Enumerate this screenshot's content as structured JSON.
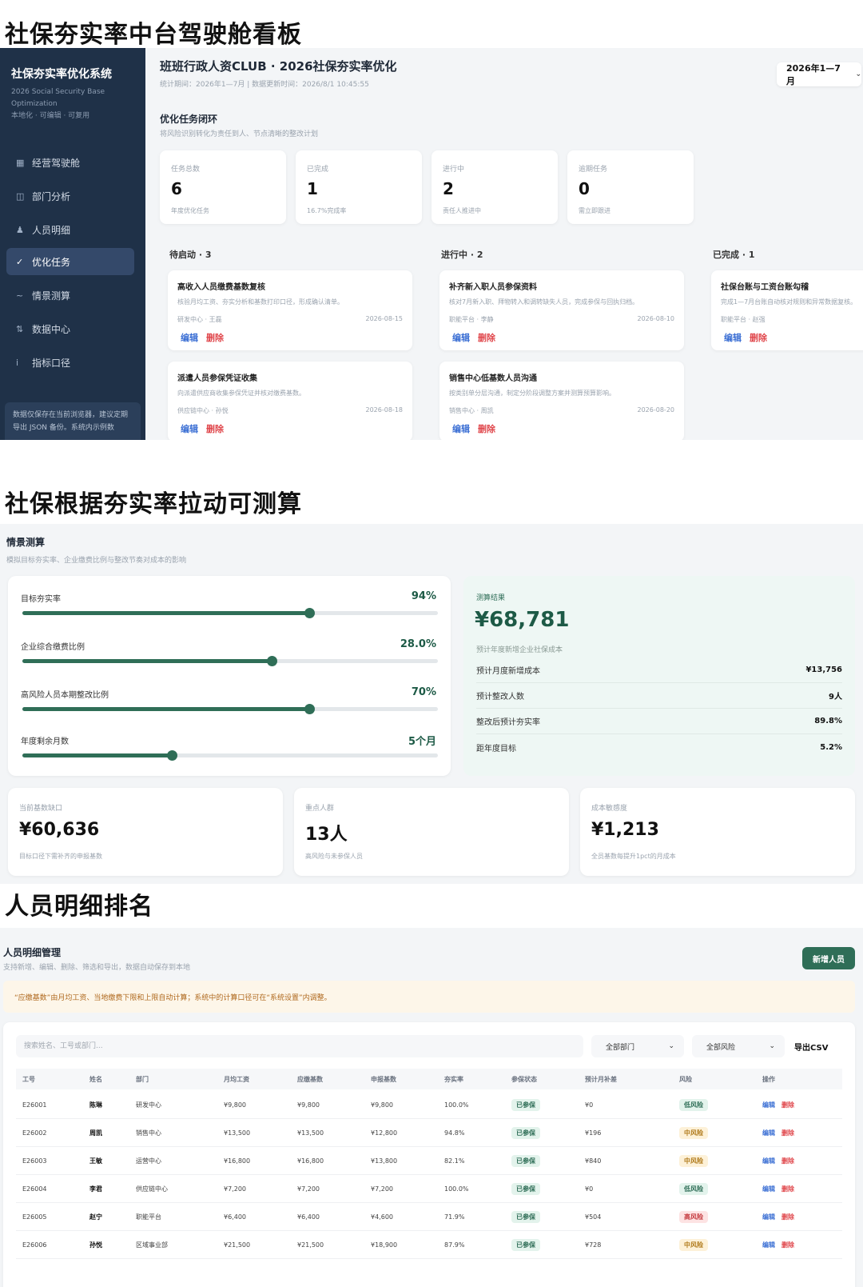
{
  "headings": {
    "h1": "社保夯实率中台驾驶舱看板",
    "h2": "社保根据夯实率拉动可测算",
    "h3": "人员明细排名"
  },
  "sidebar": {
    "title": "社保夯实率优化系统",
    "subtitle_line1": "2026 Social Security Base",
    "subtitle_line2": "Optimization",
    "subtitle_line3": "本地化 · 可编辑 · 可复用",
    "items": [
      {
        "icon": "▦",
        "label": "经营驾驶舱"
      },
      {
        "icon": "◫",
        "label": "部门分析"
      },
      {
        "icon": "♟",
        "label": "人员明细"
      },
      {
        "icon": "✓",
        "label": "优化任务"
      },
      {
        "icon": "~",
        "label": "情景测算"
      },
      {
        "icon": "⇅",
        "label": "数据中心"
      },
      {
        "icon": "i",
        "label": "指标口径"
      }
    ],
    "note": "数据仅保存在当前浏览器，建议定期导出 JSON 备份。系统内示例数"
  },
  "dashboard": {
    "title": "班班行政人资CLUB · 2026社保夯实率优化",
    "meta": "统计期间：2026年1—7月 | 数据更新时间：2026/8/1 10:45:55",
    "period": "2026年1—7月",
    "section_title": "优化任务闭环",
    "section_desc": "将风险识别转化为责任到人、节点清晰的整改计划",
    "stats": [
      {
        "label": "任务总数",
        "value": "6",
        "note": "年度优化任务"
      },
      {
        "label": "已完成",
        "value": "1",
        "note": "16.7%完成率"
      },
      {
        "label": "进行中",
        "value": "2",
        "note": "责任人推进中"
      },
      {
        "label": "逾期任务",
        "value": "0",
        "note": "需立即跟进"
      }
    ],
    "columns": [
      {
        "title": "待启动 · 3"
      },
      {
        "title": "进行中 · 2"
      },
      {
        "title": "已完成 · 1"
      }
    ],
    "tasks": [
      {
        "title": "高收入人员缴费基数复核",
        "desc": "核验月均工资、夯实分析和基数打印口径，形成确认清单。",
        "meta": "研发中心 · 王磊",
        "date": "2026-08-15",
        "edit": "编辑",
        "del": "删除"
      },
      {
        "title": "派遣人员参保凭证收集",
        "desc": "向派遣供应商收集参保凭证并核对缴费基数。",
        "meta": "供应链中心 · 孙悦",
        "date": "2026-08-18",
        "edit": "编辑",
        "del": "删除"
      },
      {
        "title": "补齐新入职人员参保资料",
        "desc": "核对7月新入职、拜物转入和调转缺失人员，完成参保与回执归档。",
        "meta": "职能平台 · 李静",
        "date": "2026-08-10",
        "edit": "编辑",
        "del": "删除"
      },
      {
        "title": "销售中心低基数人员沟通",
        "desc": "按类别单分层沟通，制定分阶段调整方案并测算预算影响。",
        "meta": "销售中心 · 周凯",
        "date": "2026-08-20",
        "edit": "编辑",
        "del": "删除"
      },
      {
        "title": "社保台账与工资台账勾稽",
        "desc": "完成1—7月台账自动核对规则和异常数据复核。",
        "meta": "职能平台 · 赵强",
        "date": "",
        "edit": "编辑",
        "del": "删除"
      }
    ]
  },
  "scenario": {
    "title": "情景测算",
    "desc": "模拟目标夯实率、企业缴费比例与整改节奏对成本的影响",
    "sliders": [
      {
        "label": "目标夯实率",
        "display": "94%",
        "fraction": 0.69
      },
      {
        "label": "企业综合缴费比例",
        "display": "28.0%",
        "fraction": 0.6
      },
      {
        "label": "高风险人员本期整改比例",
        "display": "70%",
        "fraction": 0.69
      },
      {
        "label": "年度剩余月数",
        "display": "5个月",
        "fraction": 0.36
      }
    ],
    "result": {
      "label": "测算结果",
      "value": "¥68,781",
      "note": "预计年度新增企业社保成本",
      "rows": [
        {
          "label": "预计月度新增成本",
          "value": "¥13,756"
        },
        {
          "label": "预计整改人数",
          "value": "9人"
        },
        {
          "label": "整改后预计夯实率",
          "value": "89.8%"
        },
        {
          "label": "距年度目标",
          "value": "5.2%"
        }
      ]
    },
    "cards": [
      {
        "label": "当前基数缺口",
        "value": "¥60,636",
        "note": "目标口径下需补齐的申报基数"
      },
      {
        "label": "重点人群",
        "value": "13人",
        "note": "高风险与未参保人员"
      },
      {
        "label": "成本敏感度",
        "value": "¥1,213",
        "note": "全员基数每提升1pct的月成本"
      }
    ]
  },
  "staff": {
    "title": "人员明细管理",
    "desc": "支持新增、编辑、删除、筛选和导出，数据自动保存到本地",
    "add_button": "新增人员",
    "notice": "“应缴基数”由月均工资、当地缴费下限和上限自动计算；系统中的计算口径可在“系统设置”内调整。",
    "search_placeholder": "搜索姓名、工号或部门...",
    "dept_filter": "全部部门",
    "risk_filter": "全部风险",
    "export": "导出CSV",
    "headers": [
      "工号",
      "姓名",
      "部门",
      "月均工资",
      "应缴基数",
      "申报基数",
      "夯实率",
      "参保状态",
      "预计月补差",
      "风险",
      "操作"
    ],
    "rows": [
      {
        "id": "E26001",
        "name": "陈琳",
        "dept": "研发中心",
        "salary": "¥9,800",
        "base_due": "¥9,800",
        "base_declared": "¥9,800",
        "rate": "100.0%",
        "status": "已参保",
        "gap": "¥0",
        "risk": "低风险",
        "risk_level": "low"
      },
      {
        "id": "E26002",
        "name": "周凯",
        "dept": "销售中心",
        "salary": "¥13,500",
        "base_due": "¥13,500",
        "base_declared": "¥12,800",
        "rate": "94.8%",
        "status": "已参保",
        "gap": "¥196",
        "risk": "中风险",
        "risk_level": "mid"
      },
      {
        "id": "E26003",
        "name": "王敏",
        "dept": "运营中心",
        "salary": "¥16,800",
        "base_due": "¥16,800",
        "base_declared": "¥13,800",
        "rate": "82.1%",
        "status": "已参保",
        "gap": "¥840",
        "risk": "中风险",
        "risk_level": "mid"
      },
      {
        "id": "E26004",
        "name": "李君",
        "dept": "供应链中心",
        "salary": "¥7,200",
        "base_due": "¥7,200",
        "base_declared": "¥7,200",
        "rate": "100.0%",
        "status": "已参保",
        "gap": "¥0",
        "risk": "低风险",
        "risk_level": "low"
      },
      {
        "id": "E26005",
        "name": "赵宁",
        "dept": "职能平台",
        "salary": "¥6,400",
        "base_due": "¥6,400",
        "base_declared": "¥4,600",
        "rate": "71.9%",
        "status": "已参保",
        "gap": "¥504",
        "risk": "高风险",
        "risk_level": "high"
      },
      {
        "id": "E26006",
        "name": "孙悦",
        "dept": "区域事业部",
        "salary": "¥21,500",
        "base_due": "¥21,500",
        "base_declared": "¥18,900",
        "rate": "87.9%",
        "status": "已参保",
        "gap": "¥728",
        "risk": "中风险",
        "risk_level": "mid"
      }
    ],
    "actions": {
      "edit": "编辑",
      "del": "删除"
    }
  }
}
